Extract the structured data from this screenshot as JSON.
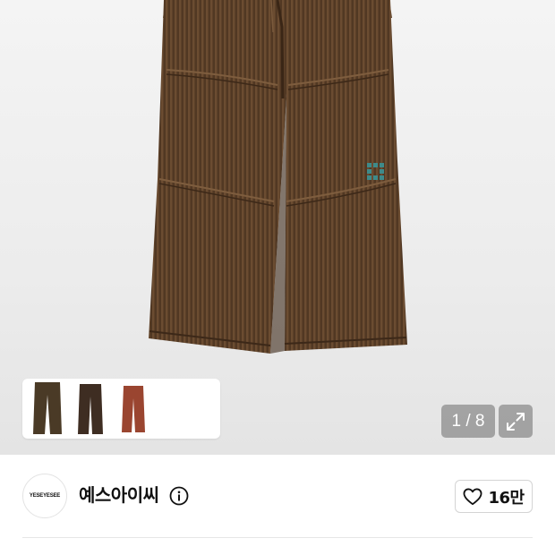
{
  "gallery": {
    "product_image": {
      "alt": "brown corduroy pants",
      "color": "#5a3f27"
    },
    "thumbnails": [
      {
        "color": "#4a3a26"
      },
      {
        "color": "#3e2d22"
      },
      {
        "color": "#9a4530"
      }
    ],
    "page_indicator": "1 / 8",
    "expand_icon": "expand-arrows-icon"
  },
  "brand": {
    "logo_text": "YESEYESEE",
    "name": "예스아이씨",
    "info_icon": "info-icon"
  },
  "like": {
    "icon": "heart-outline-icon",
    "count": "16만"
  }
}
